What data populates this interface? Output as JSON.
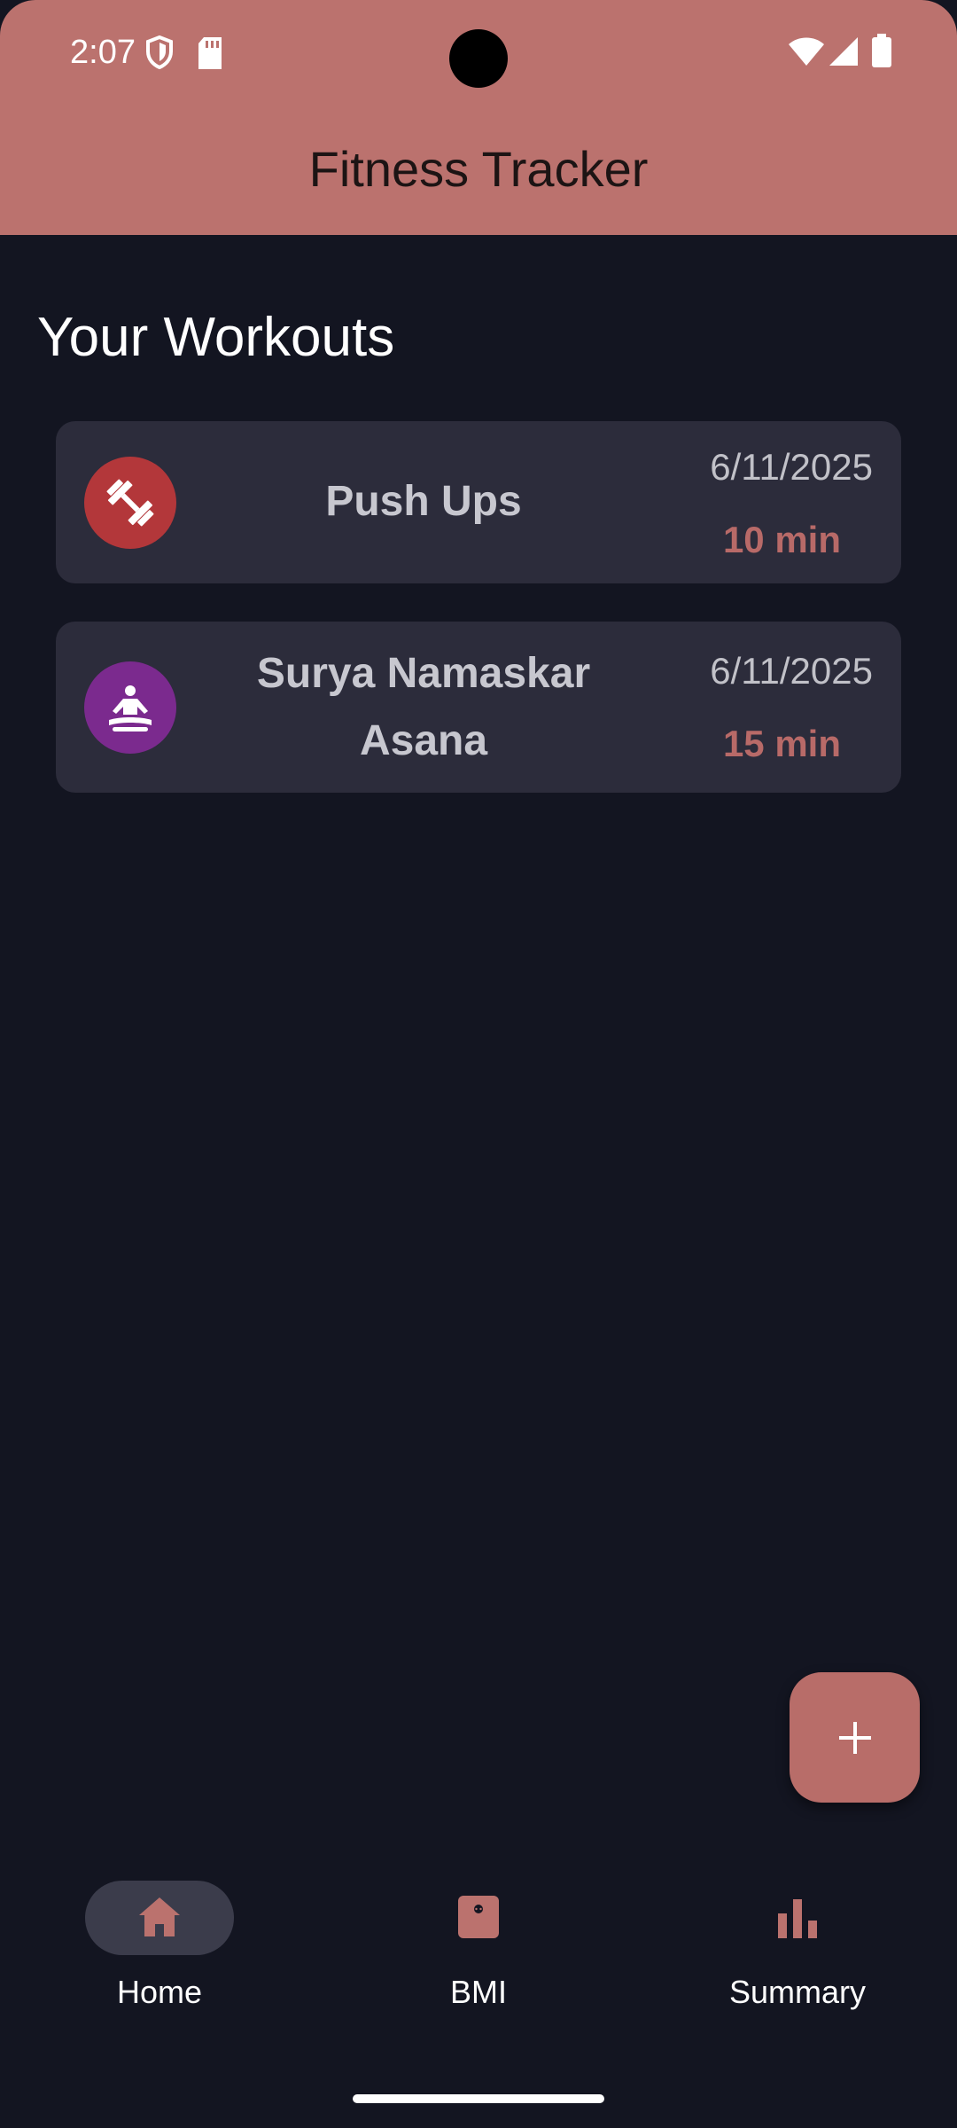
{
  "status_bar": {
    "time": "2:07"
  },
  "app_bar": {
    "title": "Fitness Tracker"
  },
  "main": {
    "section_title": "Your Workouts",
    "workouts": [
      {
        "name": "Push Ups",
        "date": "6/11/2025",
        "duration": "10 min",
        "icon": "dumbbell-icon",
        "icon_color": "#b3373a"
      },
      {
        "name": "Surya Namaskar Asana",
        "date": "6/11/2025",
        "duration": "15 min",
        "icon": "meditation-icon",
        "icon_color": "#7b2a8e"
      }
    ]
  },
  "fab": {
    "icon": "plus-icon"
  },
  "bottom_nav": {
    "items": [
      {
        "label": "Home",
        "icon": "home-icon",
        "active": true
      },
      {
        "label": "BMI",
        "icon": "scale-icon",
        "active": false
      },
      {
        "label": "Summary",
        "icon": "bar-chart-icon",
        "active": false
      }
    ]
  },
  "colors": {
    "accent": "#bb726e",
    "background": "#131521",
    "card": "#2c2c3b"
  }
}
